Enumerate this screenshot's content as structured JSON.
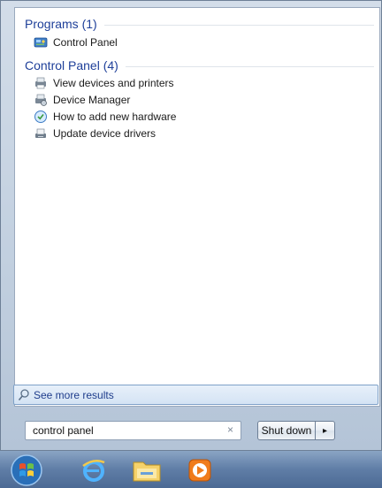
{
  "results": {
    "groups": [
      {
        "title": "Programs (1)",
        "items": [
          {
            "label": "Control Panel",
            "icon": "control-panel-icon"
          }
        ]
      },
      {
        "title": "Control Panel (4)",
        "items": [
          {
            "label": "View devices and printers",
            "icon": "devices-printers-icon"
          },
          {
            "label": "Device Manager",
            "icon": "device-manager-icon"
          },
          {
            "label": "How to add new hardware",
            "icon": "add-hardware-icon"
          },
          {
            "label": "Update device drivers",
            "icon": "device-drivers-icon"
          }
        ]
      }
    ]
  },
  "see_more": {
    "label": "See more results",
    "icon": "search-icon"
  },
  "search": {
    "value": "control panel",
    "clear_glyph": "×"
  },
  "shutdown": {
    "label": "Shut down",
    "arrow": "▸"
  },
  "taskbar": {
    "items": [
      {
        "name": "start-orb",
        "icon": "windows-logo-icon"
      },
      {
        "name": "internet-explorer",
        "icon": "internet-explorer-icon"
      },
      {
        "name": "file-explorer",
        "icon": "folder-icon"
      },
      {
        "name": "media-player",
        "icon": "media-player-icon"
      }
    ]
  },
  "colors": {
    "group_title": "#1e3f99",
    "see_more_bg": "#d4e3f4",
    "taskbar": "#5f7da6"
  }
}
